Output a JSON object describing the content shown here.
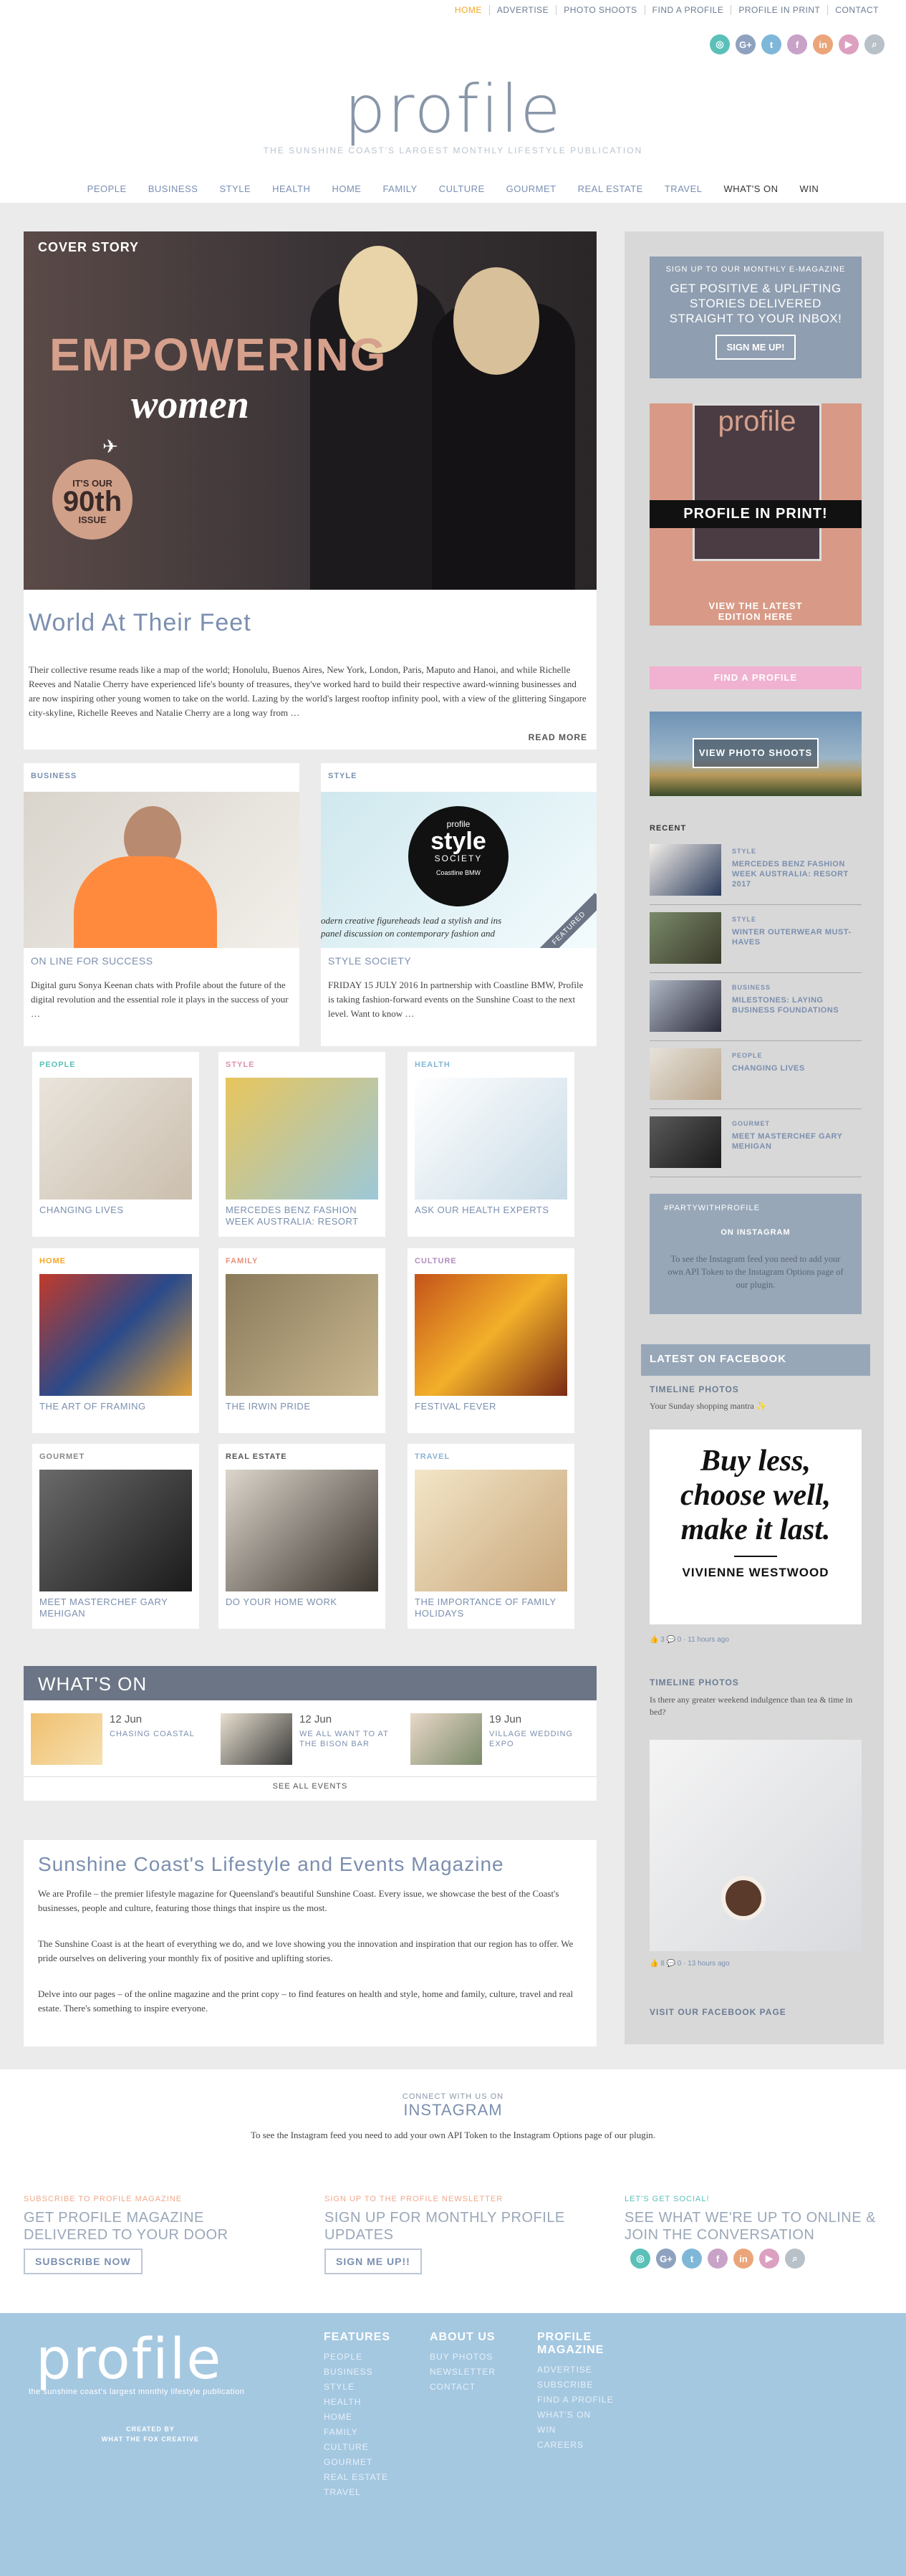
{
  "top_nav": [
    "HOME",
    "ADVERTISE",
    "PHOTO SHOOTS",
    "FIND A PROFILE",
    "PROFILE IN PRINT",
    "CONTACT"
  ],
  "social": [
    {
      "icon": "instagram-icon",
      "glyph": "◎",
      "color": "#5bc0b8"
    },
    {
      "icon": "google-plus-icon",
      "glyph": "G+",
      "color": "#8ea2bf"
    },
    {
      "icon": "twitter-icon",
      "glyph": "t",
      "color": "#7fb7d9"
    },
    {
      "icon": "facebook-icon",
      "glyph": "f",
      "color": "#c9a2c8"
    },
    {
      "icon": "linkedin-icon",
      "glyph": "in",
      "color": "#eba57a"
    },
    {
      "icon": "youtube-icon",
      "glyph": "▶",
      "color": "#dca0c0"
    },
    {
      "icon": "search-icon",
      "glyph": "⌕",
      "color": "#b8c0c8"
    }
  ],
  "logo": {
    "word": "profile",
    "tagline": "THE SUNSHINE COAST'S LARGEST MONTHLY LIFESTYLE PUBLICATION"
  },
  "main_nav": [
    "PEOPLE",
    "BUSINESS",
    "STYLE",
    "HEALTH",
    "HOME",
    "FAMILY",
    "CULTURE",
    "GOURMET",
    "REAL ESTATE",
    "TRAVEL",
    "WHAT'S ON",
    "WIN"
  ],
  "cover": {
    "label": "COVER STORY",
    "headline1": "EMPOWERING",
    "headline2": "women",
    "badge_top": "IT'S OUR",
    "badge_num": "90th",
    "badge_bottom": "ISSUE",
    "title": "World At Their Feet",
    "text": "Their collective resume reads like a map of the world; Honolulu, Buenos Aires, New York, London, Paris, Maputo and Hanoi, and while Richelle Reeves and Natalie Cherry have experienced life's bounty of treasures, they've worked hard to build their respective award-winning businesses and are now inspiring other young women to take on the world. Lazing by the world's largest rooftop infinity pool, with a view of the glittering Singapore city-skyline, Richelle Reeves and Natalie Cherry are a long way from …",
    "read_more": "READ MORE"
  },
  "duo": [
    {
      "section": "BUSINESS",
      "title": "ON LINE FOR SUCCESS",
      "text": "Digital guru Sonya Keenan chats with Profile about the future of the digital revolution and the essential role it plays in the success of your …"
    },
    {
      "section": "STYLE",
      "title": "STYLE SOCIETY",
      "text": "FRIDAY 15 JULY 2016 In partnership with Coastline BMW, Profile is taking fashion-forward events on the Sunshine Coast to the next level. Want to know …",
      "overlay_small": "profile",
      "overlay_big": "style",
      "overlay_sub": "SOCIETY",
      "overlay_by": "Coastline BMW",
      "overlay_line": "odern creative figureheads lead a stylish and ins",
      "overlay_line2": "panel discussion on contemporary fashion and",
      "featured": "FEATURED"
    }
  ],
  "grid": [
    {
      "section": "PEOPLE",
      "color": "#5bc0b8",
      "title": "CHANGING LIVES"
    },
    {
      "section": "STYLE",
      "color": "#e08fb0",
      "title": "MERCEDES BENZ FASHION WEEK AUSTRALIA: RESORT"
    },
    {
      "section": "HEALTH",
      "color": "#7fb7d9",
      "title": "ASK OUR HEALTH EXPERTS"
    },
    {
      "section": "HOME",
      "color": "#f5a623",
      "title": "THE ART OF FRAMING"
    },
    {
      "section": "FAMILY",
      "color": "#e8907a",
      "title": "THE IRWIN PRIDE"
    },
    {
      "section": "CULTURE",
      "color": "#b28cc0",
      "title": "FESTIVAL FEVER"
    },
    {
      "section": "GOURMET",
      "color": "#888888",
      "title": "MEET MASTERCHEF GARY MEHIGAN"
    },
    {
      "section": "REAL ESTATE",
      "color": "#555555",
      "title": "DO YOUR HOME WORK"
    },
    {
      "section": "TRAVEL",
      "color": "#8ab3d4",
      "title": "THE IMPORTANCE OF FAMILY HOLIDAYS"
    }
  ],
  "whats_on": {
    "title": "WHAT'S ON",
    "events": [
      {
        "date": "12 Jun",
        "name": "CHASING COASTAL"
      },
      {
        "date": "12 Jun",
        "name": "WE ALL WANT TO AT THE BISON BAR"
      },
      {
        "date": "19 Jun",
        "name": "VILLAGE WEDDING EXPO"
      }
    ],
    "see_all": "SEE ALL EVENTS"
  },
  "about": {
    "title": "Sunshine Coast's Lifestyle and Events Magazine",
    "p1": "We are Profile – the premier lifestyle magazine for Queensland's beautiful Sunshine Coast. Every issue, we showcase the best of the Coast's businesses, people and culture, featuring those things that inspire us the most.",
    "p2": "The Sunshine Coast is at the heart of everything we do, and we love showing you the innovation and inspiration that our region has to offer. We pride ourselves on delivering your monthly fix of positive and uplifting stories.",
    "p3": "Delve into our pages – of the online magazine and the print copy – to find features on health and style, home and family, culture, travel and real estate. There's something to inspire everyone."
  },
  "sidebar": {
    "newsletter": {
      "small": "SIGN UP TO OUR MONTHLY E-MAGAZINE",
      "big": "GET POSITIVE & UPLIFTING STORIES DELIVERED STRAIGHT TO YOUR INBOX!",
      "button": "SIGN ME UP!"
    },
    "print": {
      "logo": "profile",
      "banner": "PROFILE IN PRINT!",
      "cta": "VIEW THE LATEST EDITION HERE"
    },
    "find": "FIND A PROFILE",
    "photo": "VIEW PHOTO SHOOTS",
    "recent_title": "RECENT",
    "recent": [
      {
        "cat": "STYLE",
        "title": "MERCEDES BENZ FASHION WEEK AUSTRALIA: RESORT 2017"
      },
      {
        "cat": "STYLE",
        "title": "WINTER OUTERWEAR MUST-HAVES"
      },
      {
        "cat": "BUSINESS",
        "title": "MILESTONES: LAYING BUSINESS FOUNDATIONS"
      },
      {
        "cat": "PEOPLE",
        "title": "CHANGING LIVES"
      },
      {
        "cat": "GOURMET",
        "title": "MEET MASTERCHEF GARY MEHIGAN"
      }
    ],
    "insta": {
      "tag": "#PARTYWITHPROFILE",
      "sub": "ON INSTAGRAM",
      "text": "To see the Instagram feed you need to add your own API Token to the Instagram Options page of our plugin."
    },
    "fb": {
      "title": "LATEST ON FACEBOOK",
      "t1": "TIMELINE PHOTOS",
      "s1": "Your Sunday shopping mantra ✨",
      "quote1": "Buy less,",
      "quote2": "choose well,",
      "quote3": "make it last.",
      "quote_by": "VIVIENNE WESTWOOD",
      "meta1": "👍 3  💬 0  · 11 hours ago",
      "t2": "TIMELINE PHOTOS",
      "s2": "Is there any greater weekend indulgence than tea & time in bed?",
      "meta2": "👍 8  💬 0  · 13 hours ago",
      "visit": "VISIT OUR FACEBOOK PAGE"
    }
  },
  "insta_strip": {
    "small": "CONNECT WITH US ON",
    "title": "INSTAGRAM",
    "text": "To see the Instagram feed you need to add your own API Token to the Instagram Options page of our plugin."
  },
  "cta": [
    {
      "small": "SUBSCRIBE TO PROFILE MAGAZINE",
      "big": "GET PROFILE MAGAZINE DELIVERED TO YOUR DOOR",
      "button": "SUBSCRIBE NOW"
    },
    {
      "small": "SIGN UP TO THE PROFILE NEWSLETTER",
      "big": "SIGN UP FOR MONTHLY PROFILE UPDATES",
      "button": "SIGN ME UP!!"
    },
    {
      "small": "LET'S GET SOCIAL!",
      "big": "SEE WHAT WE'RE UP TO ONLINE & JOIN THE CONVERSATION"
    }
  ],
  "footer": {
    "logo": "profile",
    "tagline": "the sunshine coast's largest monthly lifestyle publication",
    "created1": "CREATED BY",
    "created2": "WHAT THE FOX CREATIVE",
    "cols": [
      {
        "title": "FEATURES",
        "items": [
          "PEOPLE",
          "BUSINESS",
          "STYLE",
          "HEALTH",
          "HOME",
          "FAMILY",
          "CULTURE",
          "GOURMET",
          "REAL ESTATE",
          "TRAVEL"
        ]
      },
      {
        "title": "ABOUT US",
        "items": [
          "BUY PHOTOS",
          "NEWSLETTER",
          "CONTACT"
        ]
      },
      {
        "title": "PROFILE MAGAZINE",
        "items": [
          "ADVERTISE",
          "SUBSCRIBE",
          "FIND A PROFILE",
          "WHAT'S ON",
          "WIN",
          "CAREERS"
        ]
      }
    ]
  }
}
